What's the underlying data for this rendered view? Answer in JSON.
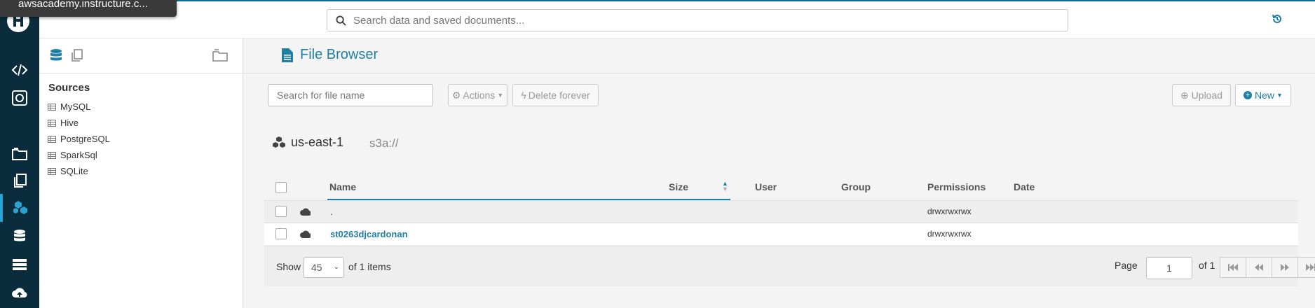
{
  "tooltip": "awsacademy.instructure.c...",
  "search": {
    "placeholder": "Search data and saved documents..."
  },
  "sidebar": {
    "sources_title": "Sources",
    "sources": [
      "MySQL",
      "Hive",
      "PostgreSQL",
      "SparkSql",
      "SQLite"
    ]
  },
  "main": {
    "title": "File Browser",
    "file_search_placeholder": "Search for file name",
    "actions_label": "Actions",
    "delete_label": "Delete forever",
    "upload_label": "Upload",
    "new_label": "New",
    "path_root": "us-east-1",
    "path_proto": "s3a://"
  },
  "table": {
    "columns": [
      "Name",
      "Size",
      "User",
      "Group",
      "Permissions",
      "Date"
    ],
    "rows": [
      {
        "name": ".",
        "size": "",
        "user": "",
        "group": "",
        "permissions": "drwxrwxrwx",
        "date": ""
      },
      {
        "name": "st0263djcardonan",
        "size": "",
        "user": "",
        "group": "",
        "permissions": "drwxrwxrwx",
        "date": ""
      }
    ]
  },
  "footer": {
    "show_label": "Show",
    "page_size": "45",
    "items_label": "of 1 items",
    "page_label": "Page",
    "page_value": "1",
    "of_pages": "of 1"
  },
  "colors": {
    "sidebar_bg": "#0b2c3d",
    "accent": "#1f7fa6",
    "active_bar": "#29a3d1"
  }
}
